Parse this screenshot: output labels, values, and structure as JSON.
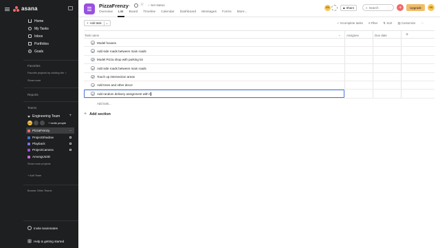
{
  "sidebar": {
    "brand": "asana",
    "nav": [
      {
        "label": "Home",
        "icon": "home-icon"
      },
      {
        "label": "My Tasks",
        "icon": "check-circle-icon"
      },
      {
        "label": "Inbox",
        "icon": "inbox-icon"
      },
      {
        "label": "Portfolios",
        "icon": "portfolio-icon"
      },
      {
        "label": "Goals",
        "icon": "goal-icon"
      }
    ],
    "favorites_label": "Favorites",
    "favorites_hint": "Favorite projects by clicking the ☆",
    "show_more": "Show more",
    "reports_label": "Reports",
    "teams_label": "Teams",
    "team_name": "Engineering Team",
    "member_initials": "KN",
    "invite_people": "Invite people",
    "projects": [
      {
        "name": "PizzaFrenzy",
        "color": "#f06a6a",
        "active": true
      },
      {
        "name": "ProjectShadow",
        "color": "#4573d2",
        "locked": true
      },
      {
        "name": "Playback",
        "color": "#7a6ff0",
        "locked": true
      },
      {
        "name": "ProjectCamera",
        "color": "#9b51e0",
        "locked": true
      },
      {
        "name": "AmongUs3D",
        "color": "#c86dd7"
      }
    ],
    "show_more_projects": "Show more projects",
    "add_team": "Add Team",
    "browse_teams": "Browse Other Teams",
    "invite_teammates": "Invite teammates",
    "help": "Help & getting started"
  },
  "header": {
    "project_title": "PizzaFrenzy",
    "set_status": "Set status",
    "tabs": [
      "Overview",
      "List",
      "Board",
      "Timeline",
      "Calendar",
      "Dashboard",
      "Messages",
      "Forms",
      "More..."
    ],
    "active_tab": "List",
    "avatar_initials": "KN",
    "share": "Share",
    "search": "Search",
    "upgrade": "Upgrade",
    "user_initials": "KN",
    "accent": "#9b51e0"
  },
  "toolbar": {
    "add_task": "Add task",
    "incomplete": "Incomplete tasks",
    "filter": "Filter",
    "sort": "Sort",
    "customize": "Customize"
  },
  "table": {
    "columns": [
      "Task name",
      "Assignee",
      "Due date"
    ],
    "rows": [
      "Model houses",
      "Add side roads between main roads",
      "Model Pizza shop with parking lot",
      "Add side roads between main roads",
      "Touch up intersection areas",
      "Add trees and other decor",
      "Add random delivery assignment with t"
    ],
    "add_task_link": "Add task...",
    "add_section": "Add section"
  }
}
